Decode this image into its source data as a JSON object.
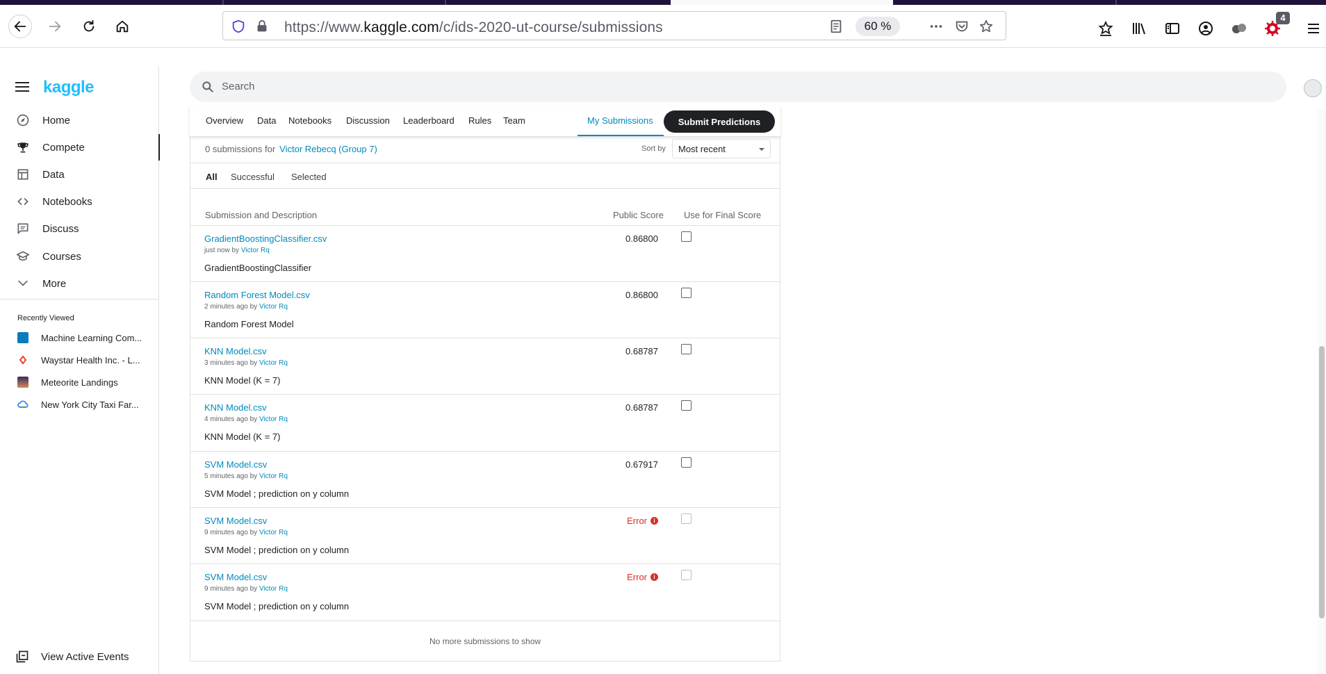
{
  "browser": {
    "url_prefix": "https://www.",
    "url_host": "kaggle.com",
    "url_path": "/c/ids-2020-ut-course/submissions",
    "zoom": "60 %",
    "notification_count": "4"
  },
  "sidebar": {
    "logo": "kaggle",
    "items": [
      {
        "label": "Home",
        "icon": "compass-icon"
      },
      {
        "label": "Compete",
        "icon": "trophy-icon"
      },
      {
        "label": "Data",
        "icon": "table-icon"
      },
      {
        "label": "Notebooks",
        "icon": "code-icon"
      },
      {
        "label": "Discuss",
        "icon": "comment-icon"
      },
      {
        "label": "Courses",
        "icon": "school-icon"
      },
      {
        "label": "More",
        "icon": "chevron-down-icon"
      }
    ],
    "recent_title": "Recently Viewed",
    "recent": [
      {
        "label": "Machine Learning Com...",
        "color": "#0a7bbd"
      },
      {
        "label": "Waystar Health Inc. - L...",
        "color": "#e8442d"
      },
      {
        "label": "Meteorite Landings",
        "color": "#3a2a5a"
      },
      {
        "label": "New York City Taxi Far...",
        "color": "#4285f4"
      }
    ],
    "view_events": "View Active Events"
  },
  "search": {
    "placeholder": "Search"
  },
  "tabs": {
    "items": [
      "Overview",
      "Data",
      "Notebooks",
      "Discussion",
      "Leaderboard",
      "Rules",
      "Team"
    ],
    "my_submissions": "My Submissions",
    "submit": "Submit Predictions"
  },
  "summary": {
    "count_text": "0 submissions for",
    "team": "Victor Rebecq (Group 7)",
    "sort_label": "Sort by",
    "sort_value": "Most recent"
  },
  "filters": [
    "All",
    "Successful",
    "Selected"
  ],
  "table": {
    "headers": [
      "Submission and Description",
      "Public Score",
      "Use for Final Score"
    ],
    "rows": [
      {
        "file": "GradientBoostingClassifier.csv",
        "time": "just now by",
        "user": "Victor Rq",
        "desc": "GradientBoostingClassifier",
        "score": "0.86800",
        "error": false
      },
      {
        "file": "Random Forest Model.csv",
        "time": "2 minutes ago by",
        "user": "Victor Rq",
        "desc": "Random Forest Model",
        "score": "0.86800",
        "error": false
      },
      {
        "file": "KNN Model.csv",
        "time": "3 minutes ago by",
        "user": "Victor Rq",
        "desc": "KNN Model (K = 7)",
        "score": "0.68787",
        "error": false
      },
      {
        "file": "KNN Model.csv",
        "time": "4 minutes ago by",
        "user": "Victor Rq",
        "desc": "KNN Model (K = 7)",
        "score": "0.68787",
        "error": false
      },
      {
        "file": "SVM Model.csv",
        "time": "5 minutes ago by",
        "user": "Victor Rq",
        "desc": "SVM Model ; prediction on y column",
        "score": "0.67917",
        "error": false
      },
      {
        "file": "SVM Model.csv",
        "time": "9 minutes ago by",
        "user": "Victor Rq",
        "desc": "SVM Model ; prediction on y column",
        "score": "Error",
        "error": true
      },
      {
        "file": "SVM Model.csv",
        "time": "9 minutes ago by",
        "user": "Victor Rq",
        "desc": "SVM Model ; prediction on y column",
        "score": "Error",
        "error": true
      }
    ],
    "footer": "No more submissions to show"
  }
}
